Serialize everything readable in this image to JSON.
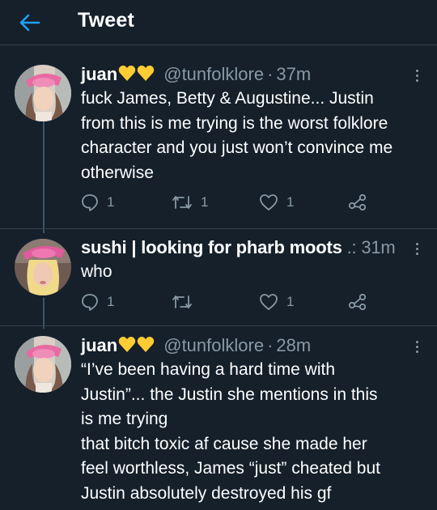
{
  "header": {
    "title": "Tweet"
  },
  "tweets": [
    {
      "name": "juan",
      "handle": "@tunfolklore",
      "time": "37m",
      "body": [
        "fuck James, Betty & Augustine... Justin",
        "from this is me trying is the worst folklore",
        "character and you just won’t convince me",
        "otherwise"
      ],
      "replies": "1",
      "retweets": "1",
      "likes": "1"
    },
    {
      "name": "sushi | looking for pharb moots",
      "name_suffix": ".:",
      "time": "31m",
      "body": [
        "who"
      ],
      "replies": "1",
      "retweets": "",
      "likes": "1"
    },
    {
      "name": "juan",
      "handle": "@tunfolklore",
      "time": "28m",
      "body": [
        "“I’ve been having a hard time with",
        "Justin”... the Justin she mentions in this",
        "is me trying",
        "that bitch toxic af cause she made her",
        "feel worthless, James “just” cheated but",
        "Justin absolutely destroyed his gf"
      ]
    }
  ],
  "icons": {
    "back": "arrow-left-icon",
    "more": "more-vertical-icon",
    "reply": "reply-bubble-icon",
    "retweet": "retweet-icon",
    "like": "heart-outline-icon",
    "share": "share-icon",
    "hearts": "yellow-heart-emoji"
  },
  "colors": {
    "background": "#15202b",
    "accent": "#1da1f2",
    "secondary_text": "#8899a6",
    "divider": "#38444d",
    "heart_emoji": "#ffcc33"
  }
}
